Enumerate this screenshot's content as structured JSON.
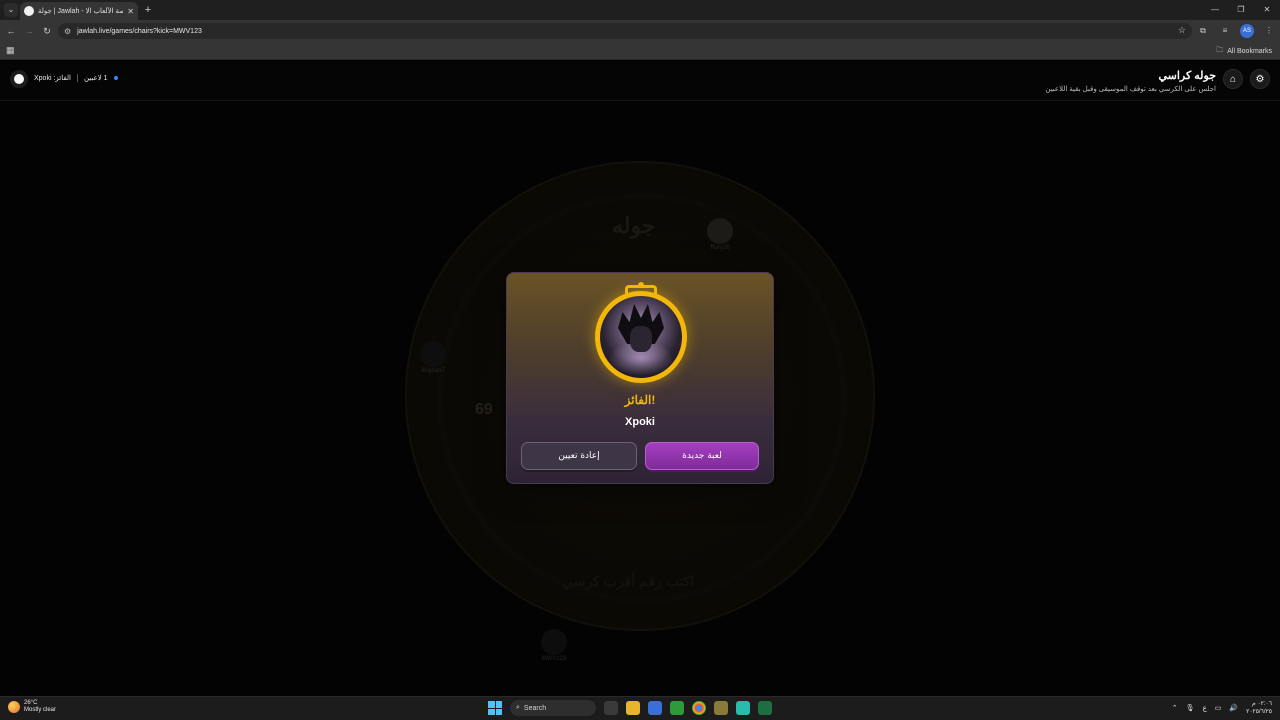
{
  "browser": {
    "tab_title": "جولة | Jawlah - منصة الألعاب الا...",
    "url": "jawlah.live/games/chairs?kick=MWV123",
    "bookmarks_label": "All Bookmarks",
    "profile_initials": "AS"
  },
  "header": {
    "title": "جوله كراسي",
    "subtitle": "اجلس على الكرسي بعد توقف الموسيقى وقبل بقية اللاعبين",
    "players_count": "1 لاعبين",
    "winner_status": "الفائز: Xpoki"
  },
  "board": {
    "word": "جوله",
    "hint": "اكتب رقم أقرب كرسي",
    "chair_number": "69",
    "players": [
      {
        "name": "Rory26"
      },
      {
        "name": "Wajdan7"
      },
      {
        "name": "MWV123"
      }
    ]
  },
  "modal": {
    "winner_label": "الفائز!",
    "winner_name": "Xpoki",
    "reset_button": "إعادة تعيين",
    "new_game_button": "لعبة جديدة"
  },
  "taskbar": {
    "temperature": "26°C",
    "weather": "Mostly clear",
    "search_placeholder": "Search",
    "time": "٠٢:٠٦ م",
    "date": "٢٠٢٥/٦/٢٥",
    "lang": "ع"
  },
  "colors": {
    "accent_gold": "#f2b70a",
    "accent_purple": "#a53ec0"
  }
}
